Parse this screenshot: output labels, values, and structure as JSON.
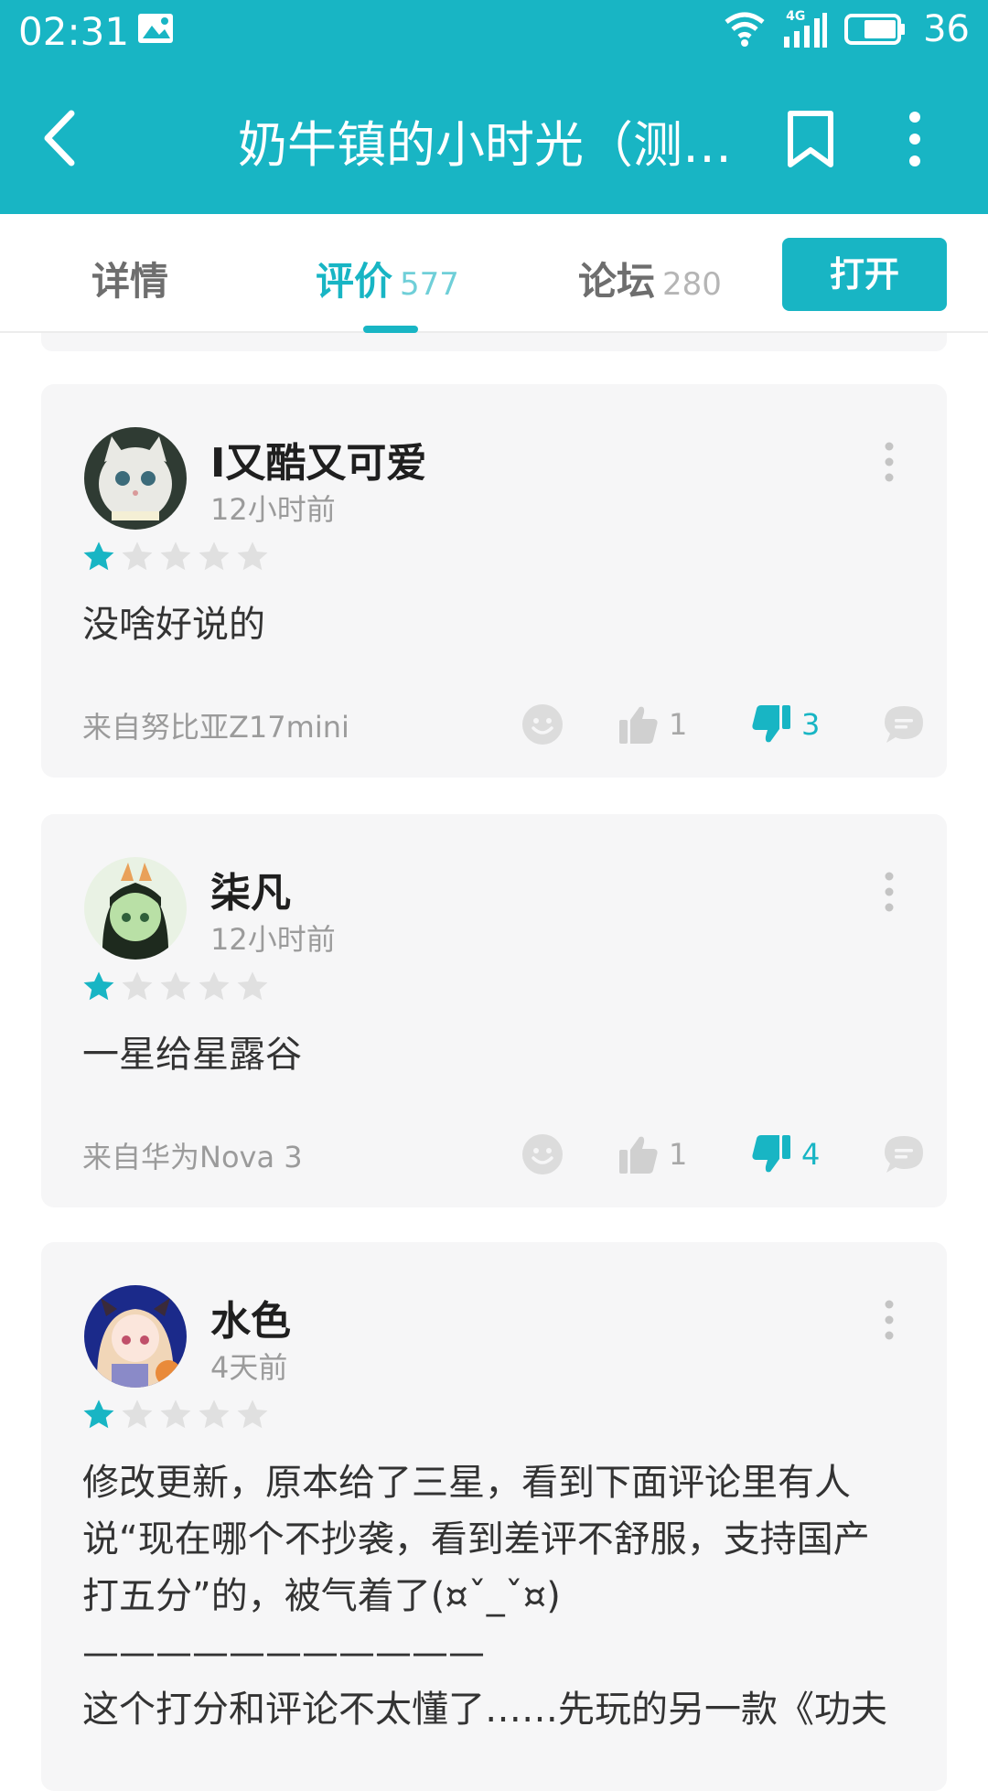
{
  "status_bar": {
    "time": "02:31",
    "network": "4G",
    "battery": "36"
  },
  "header": {
    "title": "奶牛镇的小时光（测…"
  },
  "tabs": [
    {
      "label": "详情",
      "count": ""
    },
    {
      "label": "评价",
      "count": "577"
    },
    {
      "label": "论坛",
      "count": "280"
    }
  ],
  "open_button": "打开",
  "colors": {
    "accent": "#18b5c4",
    "card_bg": "#f6f6f7",
    "star_empty": "#e0e0e0"
  },
  "reviews": [
    {
      "name": "I又酷又可爱",
      "time": "12小时前",
      "rating": 1,
      "content": "没啥好说的",
      "device": "来自努比亚Z17mini",
      "likes": "1",
      "dislikes": "3"
    },
    {
      "name": "柒凡",
      "time": "12小时前",
      "rating": 1,
      "content": "一星给星露谷",
      "device": "来自华为Nova 3",
      "likes": "1",
      "dislikes": "4"
    },
    {
      "name": "水色",
      "time": "4天前",
      "rating": 1,
      "content_lines": [
        "修改更新，原本给了三星，看到下面评论里有人",
        "说“现在哪个不抄袭，看到差评不舒服，支持国产",
        "打五分”的，被气着了(¤ˇ_ˇ¤)",
        "———————————",
        "这个打分和评论不太懂了……先玩的另一款《功夫"
      ]
    }
  ]
}
